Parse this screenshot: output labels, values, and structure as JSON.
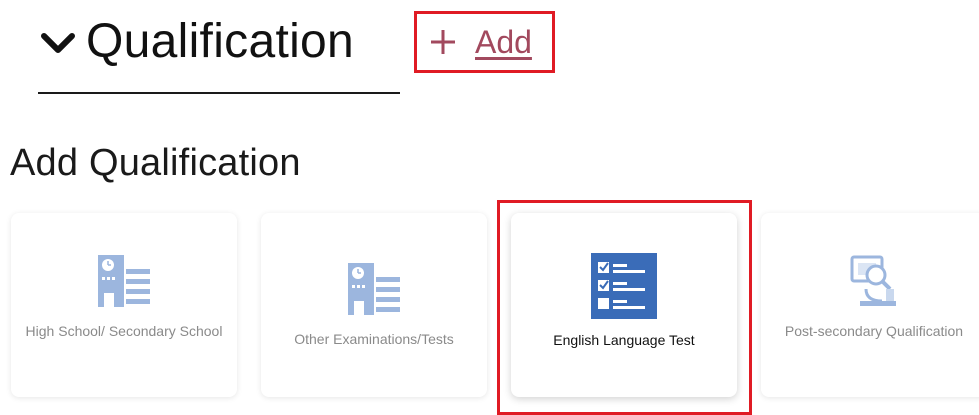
{
  "section": {
    "title": "Qualification",
    "add_label": "Add"
  },
  "subtitle": "Add Qualification",
  "cards": [
    {
      "label": "High School/ Secondary School",
      "icon": "school-building-icon"
    },
    {
      "label": "Other Examinations/Tests",
      "icon": "examination-building-icon"
    },
    {
      "label": "English Language Test",
      "icon": "checklist-icon"
    },
    {
      "label": "Post-secondary Qualification",
      "icon": "microscope-icon"
    }
  ],
  "colors": {
    "accent_red": "#e01b24",
    "link_color": "#a2495e",
    "icon_blue": "#3a6cb8",
    "icon_light_blue": "#9cb6de",
    "muted_text": "#8a8a8a"
  }
}
